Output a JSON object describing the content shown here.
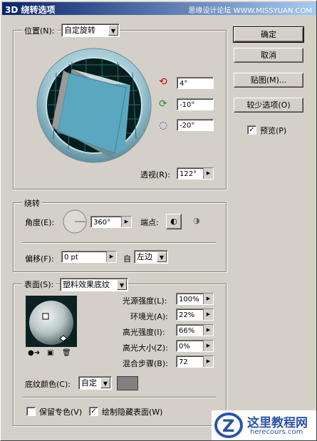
{
  "title": "3D 绕转选项",
  "watermark": "思缘设计论坛 WWW.MISSYUAN.COM",
  "position": {
    "label": "位置(N):",
    "value": "自定旋转"
  },
  "rotation": {
    "x": "4°",
    "y": "-10°",
    "z": "-20°"
  },
  "perspective": {
    "label": "透视(R):",
    "value": "122°"
  },
  "buttons": {
    "ok": "确定",
    "cancel": "取消",
    "map": "贴图(M)...",
    "fewer": "较少选项(O)",
    "preview": "预览(P)"
  },
  "revolve": {
    "group_label": "绕转",
    "angle_label": "角度(E):",
    "angle_value": "360°",
    "cap_label": "端点:",
    "offset_label": "偏移(F):",
    "offset_value": "0 pt",
    "from_label": "自",
    "from_value": "左边"
  },
  "surface": {
    "label": "表面(S):",
    "value": "塑料效果底纹",
    "light_intensity": {
      "label": "光源强度(L):",
      "value": "100%"
    },
    "ambient": {
      "label": "环境光(A):",
      "value": "22%"
    },
    "highlight_intensity": {
      "label": "高光强度(I):",
      "value": "66%"
    },
    "highlight_size": {
      "label": "高光大小(Z):",
      "value": "0%"
    },
    "blend_steps": {
      "label": "混合步骤(B):",
      "value": "72"
    },
    "shade_label": "底纹颜色(C):",
    "shade_value": "自定",
    "preserve": "保留专色(V)",
    "draw_hidden": "绘制隐藏表面(W)"
  },
  "logo": {
    "text": "这里教程网",
    "url": "herecours.com"
  },
  "colors": {
    "title_start": "#0a246a",
    "cube": "#5aa7c0",
    "grid": "#1f6f6f",
    "shade_swatch": "#808080"
  }
}
